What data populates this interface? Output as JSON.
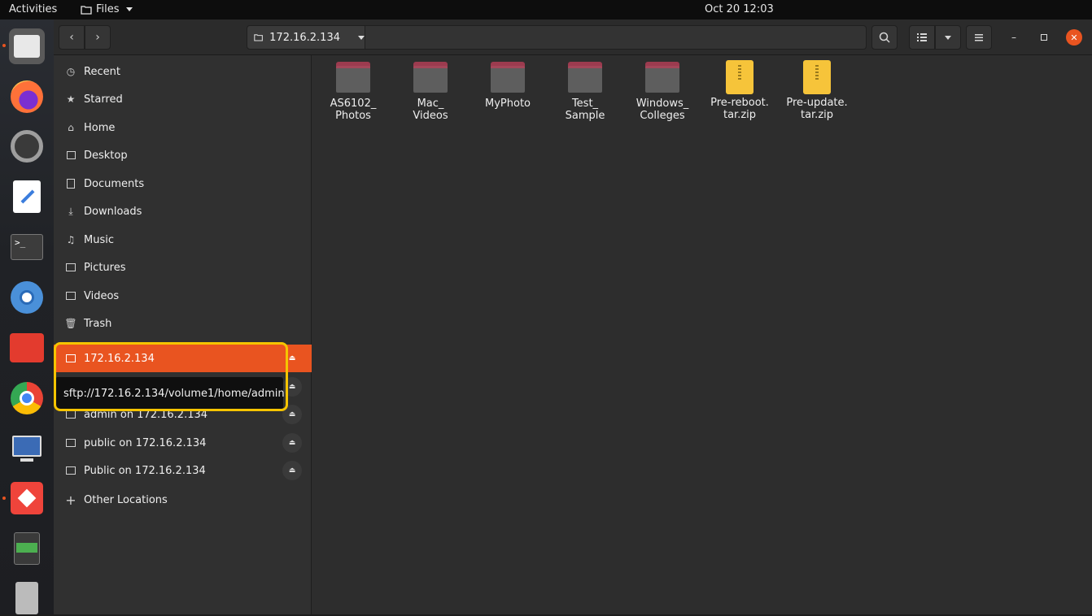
{
  "topbar": {
    "activities": "Activities",
    "app_menu": "Files",
    "clock": "Oct 20  12:03"
  },
  "dock": {
    "items": [
      {
        "name": "files-icon",
        "color": "#e8e8e8"
      },
      {
        "name": "firefox-icon",
        "color": "#ff7139"
      },
      {
        "name": "settings-icon",
        "color": "#9e9e9e"
      },
      {
        "name": "text-editor-icon",
        "color": "#ffffff"
      },
      {
        "name": "terminal-icon",
        "color": "#3c3c3c"
      },
      {
        "name": "chromium-icon",
        "color": "#4a90d9"
      },
      {
        "name": "doublecommander-icon",
        "color": "#e33b2e"
      },
      {
        "name": "chrome-icon",
        "color": "#4caf50"
      },
      {
        "name": "remote-desktop-icon",
        "color": "#3b6bb5"
      },
      {
        "name": "anydesk-icon",
        "color": "#ef443b"
      },
      {
        "name": "notes-app-icon",
        "color": "#4caf50"
      },
      {
        "name": "archive-manager-icon",
        "color": "#bbbbbb"
      }
    ]
  },
  "headerbar": {
    "path_label": "172.16.2.134"
  },
  "sidebar": {
    "items": [
      {
        "label": "Recent",
        "icon": "clock-icon"
      },
      {
        "label": "Starred",
        "icon": "star-icon"
      },
      {
        "label": "Home",
        "icon": "home-icon"
      },
      {
        "label": "Desktop",
        "icon": "desktop-icon"
      },
      {
        "label": "Documents",
        "icon": "document-icon"
      },
      {
        "label": "Downloads",
        "icon": "download-icon"
      },
      {
        "label": "Music",
        "icon": "music-icon"
      },
      {
        "label": "Pictures",
        "icon": "picture-icon"
      },
      {
        "label": "Videos",
        "icon": "video-icon"
      },
      {
        "label": "Trash",
        "icon": "trash-icon"
      }
    ],
    "network": [
      {
        "label": "172.16.2.134"
      },
      {
        "label": "admin on 172.16.2.134"
      },
      {
        "label": "public on 172.16.2.134"
      },
      {
        "label": "Public on 172.16.2.134"
      }
    ],
    "other_locations": "Other Locations",
    "tooltip": "sftp://172.16.2.134/volume1/home/admin"
  },
  "content": {
    "files": [
      {
        "label": "AS6102_\nPhotos",
        "type": "folder"
      },
      {
        "label": "Mac_\nVideos",
        "type": "folder"
      },
      {
        "label": "MyPhoto",
        "type": "folder"
      },
      {
        "label": "Test_\nSample",
        "type": "folder"
      },
      {
        "label": "Windows_\nColleges",
        "type": "folder"
      },
      {
        "label": "Pre-reboot.\ntar.zip",
        "type": "zip"
      },
      {
        "label": "Pre-update.\ntar.zip",
        "type": "zip"
      }
    ]
  },
  "colors": {
    "accent": "#e95420",
    "highlight": "#f5c400"
  }
}
